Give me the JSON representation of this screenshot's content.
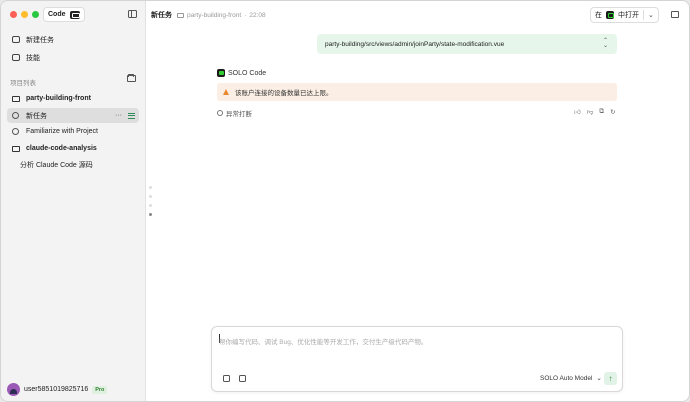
{
  "sidebar": {
    "code_label": "Code",
    "nav": [
      {
        "label": "新建任务",
        "icon": "new-task-icon"
      },
      {
        "label": "技能",
        "icon": "skills-icon"
      }
    ],
    "section_label": "项目列表",
    "projects": [
      {
        "label": "party-building-front",
        "type": "project"
      },
      {
        "label": "新任务",
        "type": "task",
        "active": true
      },
      {
        "label": "Familiarize with Project",
        "type": "task"
      },
      {
        "label": "claude-code-analysis",
        "type": "project"
      },
      {
        "label": "分析 Claude Code 源码",
        "type": "task"
      }
    ],
    "more_label": "···",
    "user": {
      "name": "user5851019825716",
      "badge": "Pro"
    }
  },
  "topbar": {
    "title": "新任务",
    "project": "party-building-front",
    "time": "22:08",
    "open_prefix": "在",
    "open_label": "中打开"
  },
  "conversation": {
    "file_path": "party-building/src/views/admin/joinParty/state-modification.vue",
    "agent_name": "SOLO Code",
    "warning": "该账户连接的设备数量已达上限。",
    "interrupted": "异常打断"
  },
  "composer": {
    "placeholder": "帮你编写代码、调试 Bug、优化性能等开发工作，交付生产级代码产物。",
    "model": "SOLO Auto Model"
  },
  "colors": {
    "accent_green": "#2e7d32",
    "path_bg": "#e6f6ea",
    "warning_bg": "#fbeee4",
    "warning_icon": "#e8892f"
  }
}
